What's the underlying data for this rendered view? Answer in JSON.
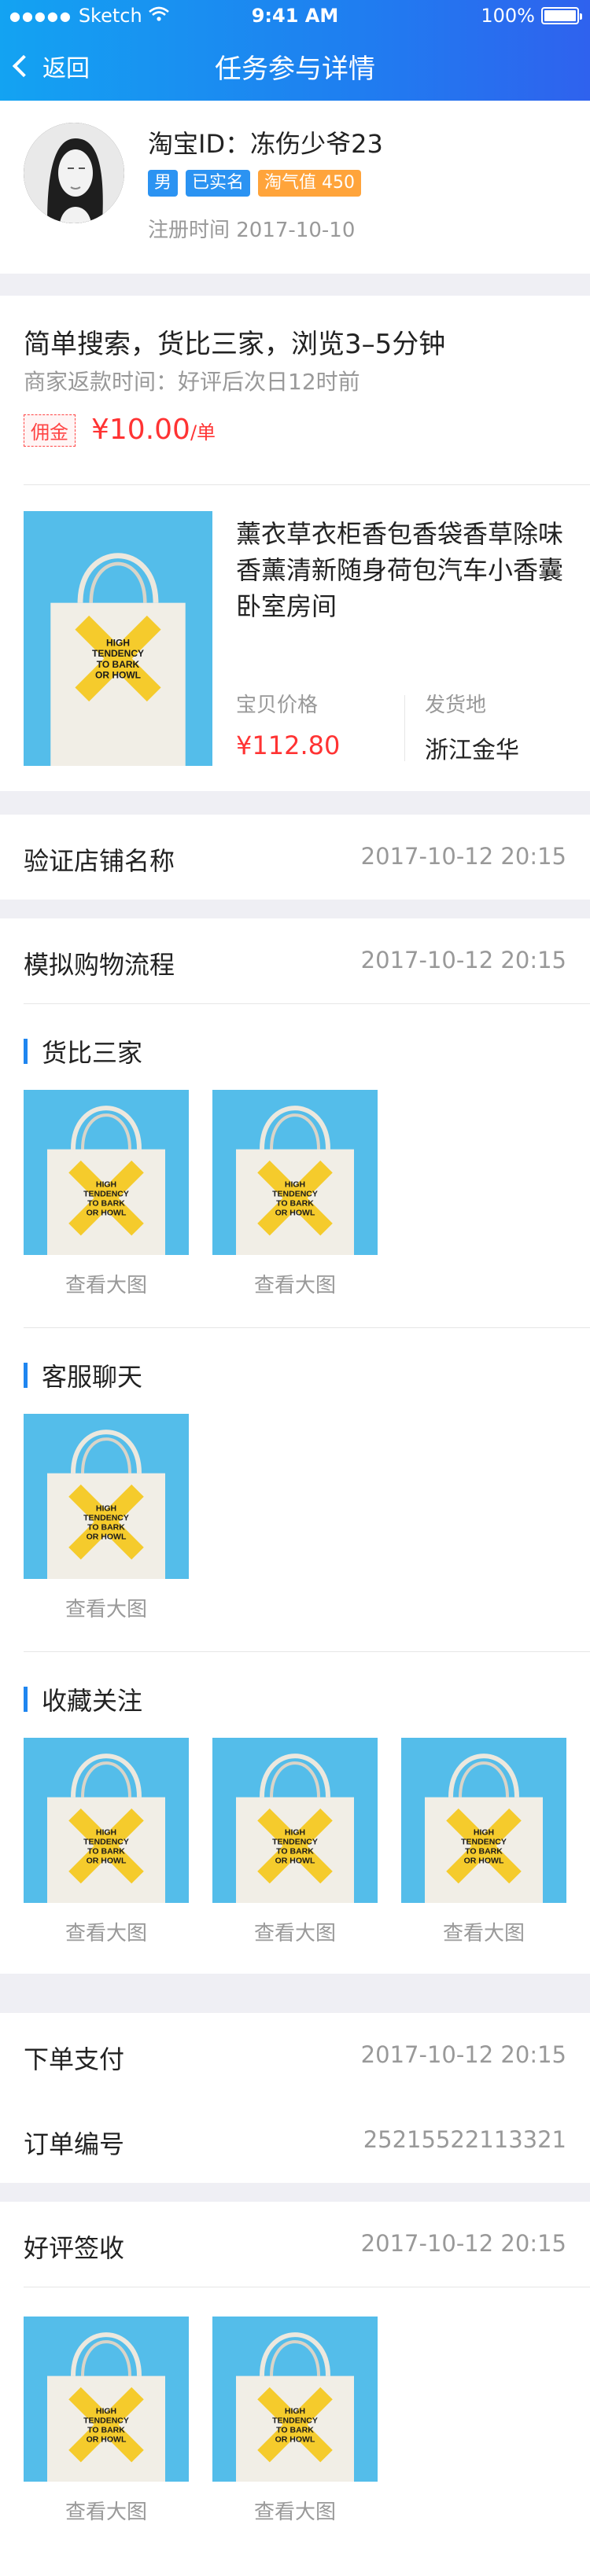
{
  "status_bar": {
    "carrier": "Sketch",
    "time": "9:41 AM",
    "battery": "100%"
  },
  "nav": {
    "back_label": "返回",
    "title": "任务参与详情"
  },
  "profile": {
    "name": "淘宝ID：冻伤少爷23",
    "tags": [
      "男",
      "已实名",
      "淘气值 450"
    ],
    "register_date": "注册时间 2017-10-10"
  },
  "task": {
    "title": "简单搜索，货比三家，浏览3–5分钟",
    "refund_note": "商家返款时间：好评后次日12时前",
    "commission_label": "佣金",
    "commission_amount": "¥10.00",
    "commission_unit": "/单",
    "product": {
      "title": "薰衣草衣柜香包香袋香草除味香薰清新随身荷包汽车小香囊卧室房间",
      "price_label": "宝贝价格",
      "price": "¥112.80",
      "ship_label": "发货地",
      "ship_from": "浙江金华",
      "bag_text": "HIGH TENDENCY TO BARK OR HOWL"
    }
  },
  "verify_shop": {
    "label": "验证店铺名称",
    "time": "2017-10-12 20:15"
  },
  "simulate": {
    "label": "模拟购物流程",
    "time": "2017-10-12 20:15",
    "view_label": "查看大图",
    "groups": [
      {
        "title": "货比三家",
        "count": 2
      },
      {
        "title": "客服聊天",
        "count": 1
      },
      {
        "title": "收藏关注",
        "count": 3
      }
    ]
  },
  "order_pay": {
    "label": "下单支付",
    "time": "2017-10-12 20:15"
  },
  "order_no": {
    "label": "订单编号",
    "value": "25215522113321"
  },
  "review": {
    "label": "好评签收",
    "time": "2017-10-12 20:15",
    "view_label": "查看大图",
    "count": 2
  },
  "colors": {
    "accent": "#1f86f0",
    "price_red": "#ff3333",
    "bag_bg": "#54bdea",
    "bag_x": "#f5cb2c"
  }
}
